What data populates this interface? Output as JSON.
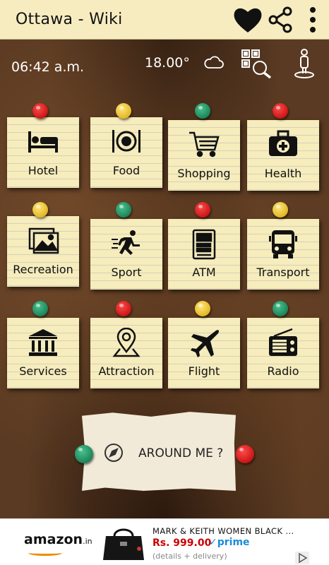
{
  "appbar": {
    "title": "Ottawa - Wiki",
    "icons": [
      "heart-icon",
      "share-icon",
      "more-vert-icon"
    ]
  },
  "status": {
    "time": "06:42 a.m.",
    "temperature": "18.00°",
    "icons": [
      "cloud-icon",
      "qr-search-icon",
      "location-person-icon"
    ]
  },
  "categories": [
    {
      "label": "Hotel",
      "icon": "bed-icon"
    },
    {
      "label": "Food",
      "icon": "plate-cutlery-icon"
    },
    {
      "label": "Shopping",
      "icon": "cart-icon"
    },
    {
      "label": "Health",
      "icon": "medical-kit-icon"
    },
    {
      "label": "Recreation",
      "icon": "picture-icon"
    },
    {
      "label": "Sport",
      "icon": "runner-icon"
    },
    {
      "label": "ATM",
      "icon": "atm-icon"
    },
    {
      "label": "Transport",
      "icon": "bus-icon"
    },
    {
      "label": "Services",
      "icon": "bank-icon"
    },
    {
      "label": "Attraction",
      "icon": "map-pin-icon"
    },
    {
      "label": "Flight",
      "icon": "airplane-icon"
    },
    {
      "label": "Radio",
      "icon": "radio-icon"
    }
  ],
  "around": {
    "label": "AROUND ME ?",
    "icon": "compass-icon"
  },
  "ad": {
    "brand": "amazon",
    "brand_suffix": ".in",
    "product": "MARK & KEITH WOMEN BLACK ...",
    "price": "Rs. 999.00",
    "prime": "prime",
    "details": "(details + delivery)"
  },
  "colors": {
    "appbar_bg": "#f7ecc0",
    "note_bg": "#f6ecbc",
    "pin_red": "#d81b1b",
    "pin_yellow": "#f2c94c",
    "pin_green": "#1e8f63",
    "price_red": "#cc0000",
    "prime_blue": "#1a8cd8"
  }
}
